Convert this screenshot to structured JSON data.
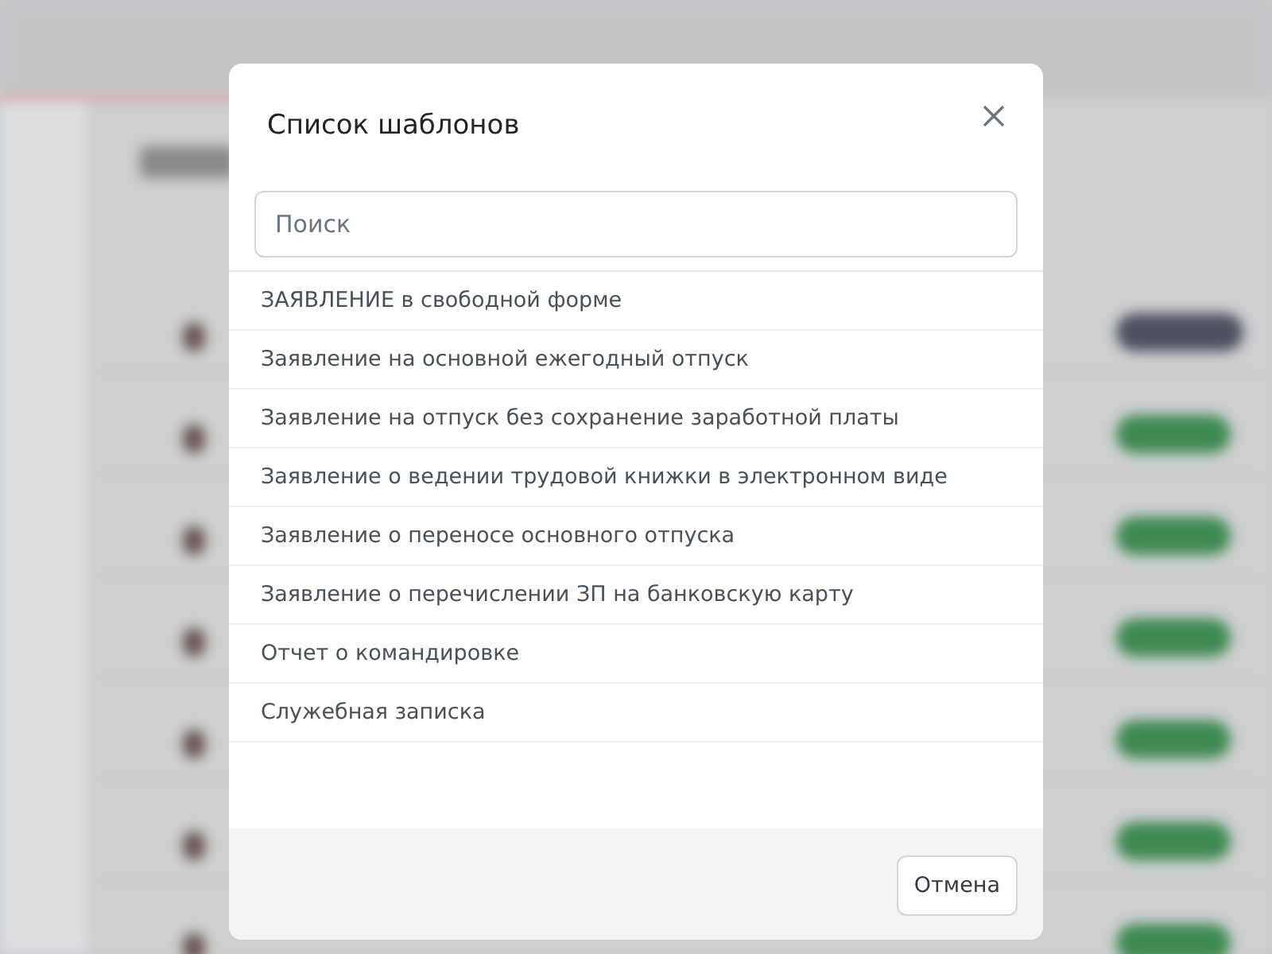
{
  "dialog": {
    "title": "Список шаблонов",
    "search": {
      "placeholder": "Поиск"
    },
    "templates": [
      {
        "label": "ЗАЯВЛЕНИЕ в свободной форме"
      },
      {
        "label": "Заявление на основной ежегодный отпуск"
      },
      {
        "label": "Заявление на отпуск без сохранение заработной платы"
      },
      {
        "label": "Заявление о ведении трудовой книжки в электронном виде"
      },
      {
        "label": "Заявление о переносе основного отпуска"
      },
      {
        "label": "Заявление о перечислении ЗП на банковскую карту"
      },
      {
        "label": "Отчет о командировке"
      },
      {
        "label": "Служебная записка"
      }
    ],
    "buttons": [
      {
        "label": "Отмена"
      }
    ]
  }
}
